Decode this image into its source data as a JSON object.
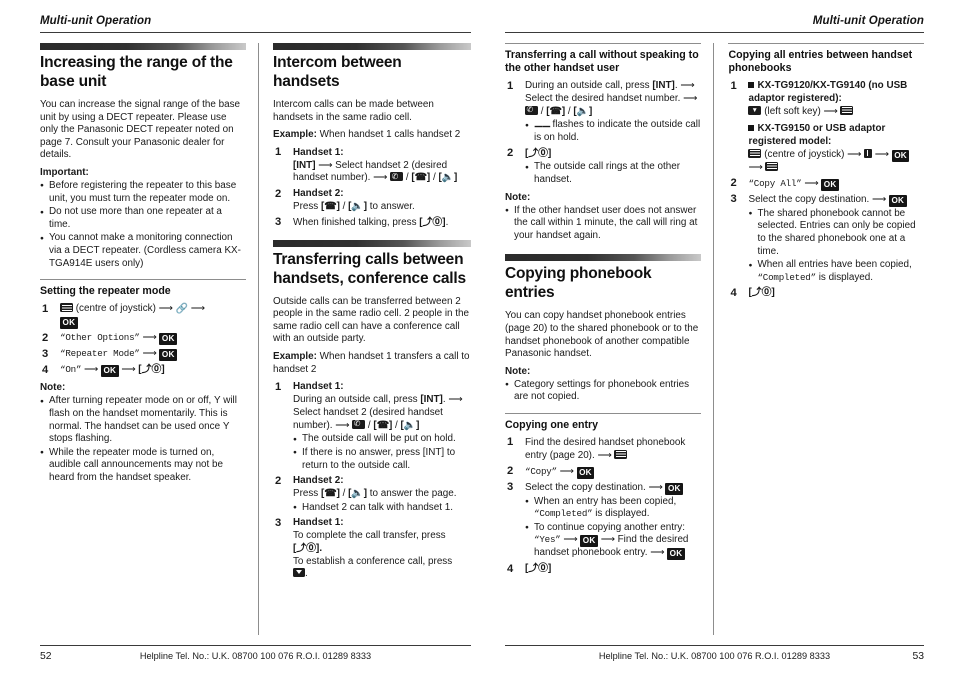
{
  "left_page": {
    "running_head": "Multi-unit Operation",
    "page_number": "52",
    "footer": "Helpline Tel. No.: U.K. 08700 100 076  R.O.I. 01289 8333",
    "col1": {
      "section_title": "Increasing the range of the base unit",
      "intro": "You can increase the signal range of the base unit by using a DECT repeater. Please use only the Panasonic DECT repeater noted on page 7. Consult your Panasonic dealer for details.",
      "important_label": "Important:",
      "important_bullets": [
        "Before registering the repeater to this base unit, you must turn the repeater mode on.",
        "Do not use more than one repeater at a time.",
        "You cannot make a monitoring connection via a DECT repeater. (Cordless camera KX-TGA914E users only)"
      ],
      "sub_title": "Setting the repeater mode",
      "step1_text": "(centre of joystick)",
      "step2_value": "“Other Options”",
      "step3_value": "“Repeater Mode”",
      "step4_value": "“On”",
      "step4_key": "[⤴⓪]",
      "note_label": "Note:",
      "note_bullets": [
        "After turning repeater mode on or off, Υ will flash on the handset momentarily. This is normal. The handset can be used once Υ stops flashing.",
        "While the repeater mode is turned on, audible call announcements may not be heard from the handset speaker."
      ]
    },
    "col2": {
      "section1_title": "Intercom between handsets",
      "section1_intro": "Intercom calls can be made between handsets in the same radio cell.",
      "section1_example_label": "Example:",
      "section1_example_text": "When handset 1 calls handset 2",
      "s1_step1_head": "Handset 1:",
      "s1_step1_body": "Select handset 2 (desired handset number).",
      "s1_step1_key": "[INT]",
      "s1_step2_head": "Handset 2:",
      "s1_step2_body_pre": "Press",
      "s1_step2_body_post": "to answer.",
      "s1_step3_body_pre": "When finished talking, press",
      "s1_step3_key": "[⤴⓪]",
      "section2_title": "Transferring calls between handsets, conference calls",
      "section2_intro": "Outside calls can be transferred between 2 people in the same radio cell. 2 people in the same radio cell can have a conference call with an outside party.",
      "section2_example_label": "Example:",
      "section2_example_text": "When handset 1 transfers a call to handset 2",
      "s2_step1_head": "Handset 1:",
      "s2_step1_body_pre": "During an outside call, press",
      "s2_step1_key": "[INT]",
      "s2_step1_body_mid": "Select handset 2 (desired handset number).",
      "s2_step1_bullets": [
        "The outside call will be put on hold.",
        "If there is no answer, press [INT] to return to the outside call."
      ],
      "s2_step2_head": "Handset 2:",
      "s2_step2_body_pre": "Press",
      "s2_step2_body_post": "to answer the page.",
      "s2_step2_bullet": "Handset 2 can talk with handset 1.",
      "s2_step3_head": "Handset 1:",
      "s2_step3_line1": "To complete the call transfer, press",
      "s2_step3_key": "[⤴⓪].",
      "s2_step3_line2": "To establish a conference call, press"
    }
  },
  "right_page": {
    "running_head": "Multi-unit Operation",
    "page_number": "53",
    "footer": "Helpline Tel. No.: U.K. 08700 100 076  R.O.I. 01289 8333",
    "col3": {
      "sub_title": "Transferring a call without speaking to the other handset user",
      "step1_pre": "During an outside call, press",
      "step1_key": "[INT]",
      "step1_mid": "Select the desired handset number.",
      "step1_bullet": "flashes to indicate the outside call is on hold.",
      "step2_key": "[⤴⓪]",
      "step2_bullet": "The outside call rings at the other handset.",
      "note_label": "Note:",
      "note_bullet": "If the other handset user does not answer the call within 1 minute, the call will ring at your handset again.",
      "section_title": "Copying phonebook entries",
      "section_intro": "You can copy handset phonebook entries (page 20) to the shared phonebook or to the handset phonebook of another compatible Panasonic handset.",
      "note2_label": "Note:",
      "note2_bullet": "Category settings for phonebook entries are not copied.",
      "sub2_title": "Copying one entry",
      "c_step1": "Find the desired handset phonebook entry (page 20).",
      "c_step2_value": "“Copy”",
      "c_step3": "Select the copy destination.",
      "c_step3_bullet1_pre": "When an entry has been copied,",
      "c_step3_bullet1_disp": "“Completed”",
      "c_step3_bullet1_post": "is displayed.",
      "c_step3_bullet2_pre": "To continue copying another entry:",
      "c_step3_bullet2_disp": "“Yes”",
      "c_step3_bullet2_post": "Find the desired handset phonebook entry.",
      "c_step4_key": "[⤴⓪]"
    },
    "col4": {
      "sub_title": "Copying all entries between handset phonebooks",
      "step1_model_a": "KX-TG9120/KX-TG9140 (no USB adaptor registered):",
      "step1_model_a_note": "(left soft key)",
      "step1_model_b": "KX-TG9150 or USB adaptor registered model:",
      "step1_model_b_note": "(centre of joystick)",
      "step2_value": "“Copy All”",
      "step3": "Select the copy destination.",
      "step3_bullets": [
        "The shared phonebook cannot be selected. Entries can only be copied to the shared phonebook one at a time.",
        "When all entries have been copied, “Completed” is displayed."
      ],
      "step3_bullet2_pre": "When all entries have been copied,",
      "step3_bullet2_disp": "“Completed”",
      "step3_bullet2_post": "is displayed.",
      "step4_key": "[⤴⓪]"
    }
  },
  "ok_chip": "OK"
}
